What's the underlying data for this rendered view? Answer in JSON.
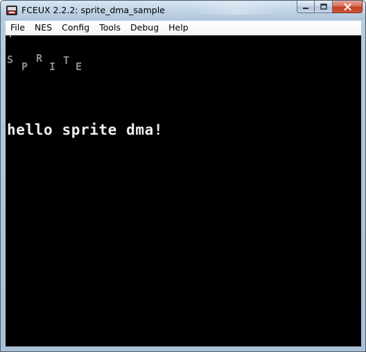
{
  "window": {
    "title": "FCEUX 2.2.2: sprite_dma_sample",
    "icon": "fceux-app-icon"
  },
  "controls": {
    "minimize_icon": "minimize-icon",
    "maximize_icon": "maximize-icon",
    "close_icon": "close-icon"
  },
  "menu": {
    "items": [
      {
        "label": "File"
      },
      {
        "label": "NES"
      },
      {
        "label": "Config"
      },
      {
        "label": "Tools"
      },
      {
        "label": "Debug"
      },
      {
        "label": "Help"
      }
    ]
  },
  "game": {
    "sprite_letters": [
      "S",
      "P",
      "R",
      "I",
      "T",
      "E"
    ],
    "message": "hello sprite dma!",
    "colors": {
      "background": "#000000",
      "sprite": "#8c8c8c",
      "text": "#f0f0f0"
    }
  }
}
